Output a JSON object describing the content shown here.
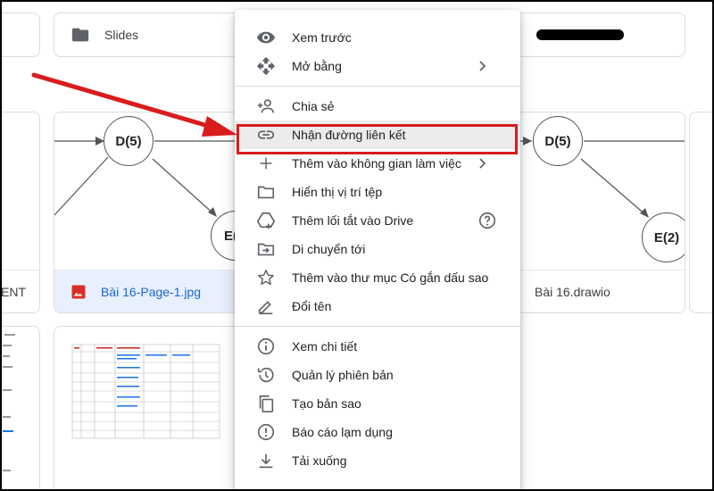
{
  "folders": [
    {
      "label": "Slides",
      "icon": "folder-icon"
    }
  ],
  "files": [
    {
      "name": "ENT",
      "state": "partial"
    },
    {
      "name": "Bài 16-Page-1.jpg",
      "icon": "image-file-icon",
      "selected": true
    },
    {
      "name": "Bài 16.drawio"
    }
  ],
  "diagram_left": {
    "nodes": [
      "D(5)",
      "E("
    ]
  },
  "diagram_right": {
    "nodes": [
      "D(5)",
      "E(2)"
    ]
  },
  "menu": {
    "groups": [
      [
        {
          "label": "Xem trước",
          "icon": "eye-icon"
        },
        {
          "label": "Mở bằng",
          "icon": "move-arrows-icon",
          "submenu": true
        }
      ],
      [
        {
          "label": "Chia sẻ",
          "icon": "person-add-icon"
        },
        {
          "label": "Nhận đường liên kết",
          "icon": "link-icon",
          "highlighted": true
        },
        {
          "label": "Thêm vào không gian làm việc",
          "icon": "plus-icon",
          "submenu": true
        },
        {
          "label": "Hiển thị vị trí tệp",
          "icon": "folder-outline-icon"
        },
        {
          "label": "Thêm lối tắt vào Drive",
          "icon": "drive-shortcut-icon",
          "help": true
        },
        {
          "label": "Di chuyển tới",
          "icon": "move-to-folder-icon"
        },
        {
          "label": "Thêm vào thư mục Có gắn dấu sao",
          "icon": "star-icon"
        },
        {
          "label": "Đổi tên",
          "icon": "pencil-icon"
        }
      ],
      [
        {
          "label": "Xem chi tiết",
          "icon": "info-icon"
        },
        {
          "label": "Quản lý phiên bản",
          "icon": "history-icon"
        },
        {
          "label": "Tạo bản sao",
          "icon": "copy-icon"
        },
        {
          "label": "Báo cáo lạm dụng",
          "icon": "report-icon"
        },
        {
          "label": "Tải xuống",
          "icon": "download-icon"
        }
      ]
    ]
  },
  "colors": {
    "highlight": "#d91c1c",
    "selected_bg": "#e8f0fe",
    "selected_text": "#1967d2",
    "image_icon": "#d93025"
  }
}
